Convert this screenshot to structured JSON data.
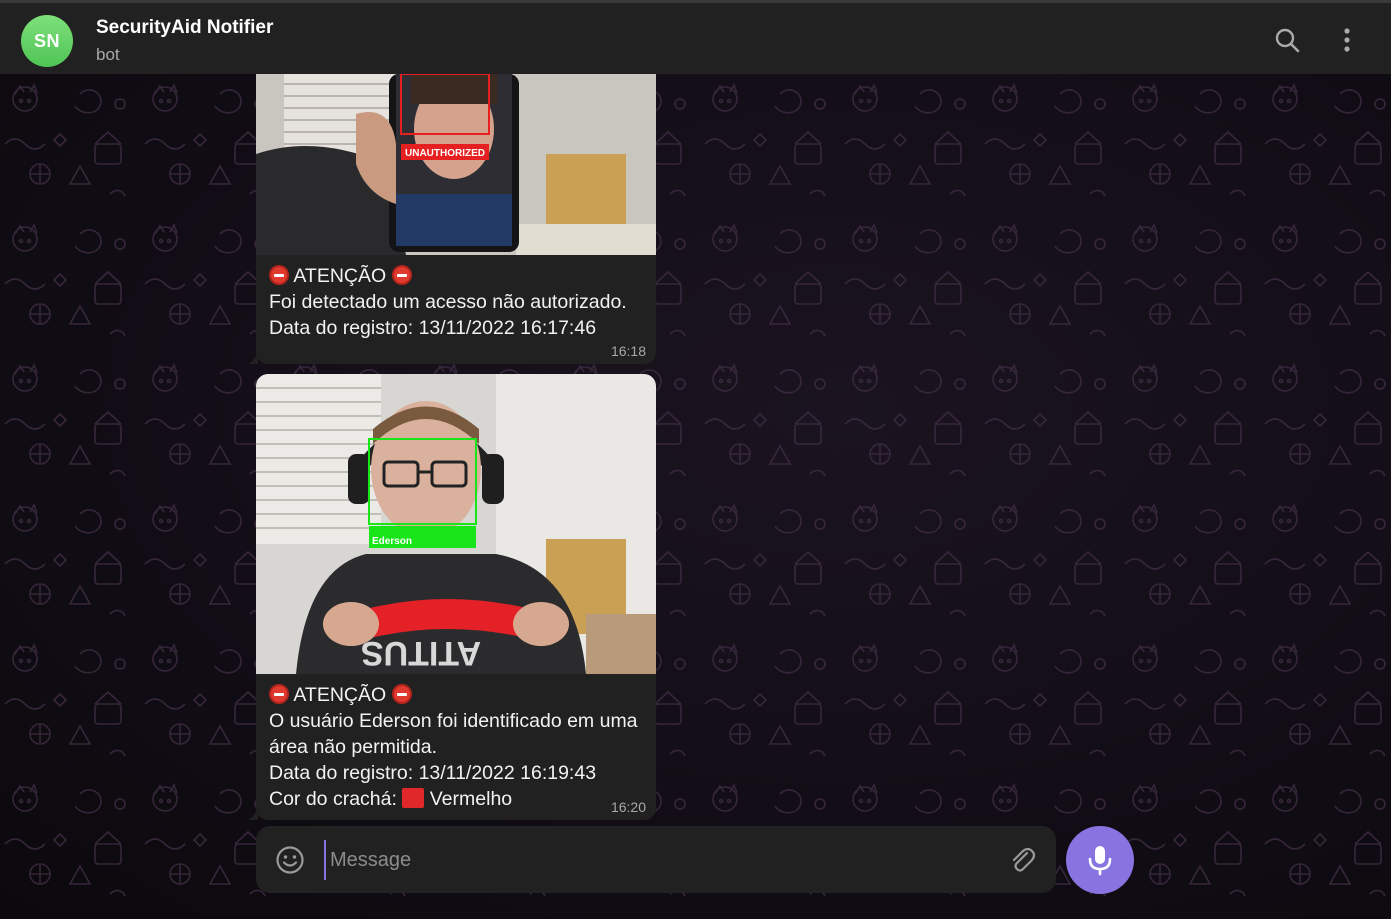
{
  "header": {
    "avatar_initials": "SN",
    "title": "SecurityAid Notifier",
    "subtitle": "bot",
    "search_icon": "search-icon",
    "menu_icon": "more-vertical-icon"
  },
  "messages": [
    {
      "photo_label": "UNAUTHORIZED",
      "heading": "ATENÇÃO",
      "lines": [
        "Foi detectado um acesso não autorizado.",
        "Data do registro: 13/11/2022 16:17:46"
      ],
      "time": "16:18"
    },
    {
      "photo_label": "Ederson",
      "heading": "ATENÇÃO",
      "lines": [
        "O usuário Ederson foi identificado em uma área não permitida.",
        "Data do registro: 13/11/2022 16:19:43"
      ],
      "badge_prefix": "Cor do crachá:",
      "badge_color_name": "Vermelho",
      "time": "16:20"
    }
  ],
  "composer": {
    "placeholder": "Message",
    "emoji_icon": "smile-icon",
    "attach_icon": "paperclip-icon",
    "mic_icon": "microphone-icon"
  },
  "colors": {
    "accent": "#8774e1",
    "avatar": "#5fcf62",
    "bubble": "#212121",
    "header": "#212121",
    "unauthorized_box": "#e62020",
    "authorized_box": "#19e619"
  }
}
